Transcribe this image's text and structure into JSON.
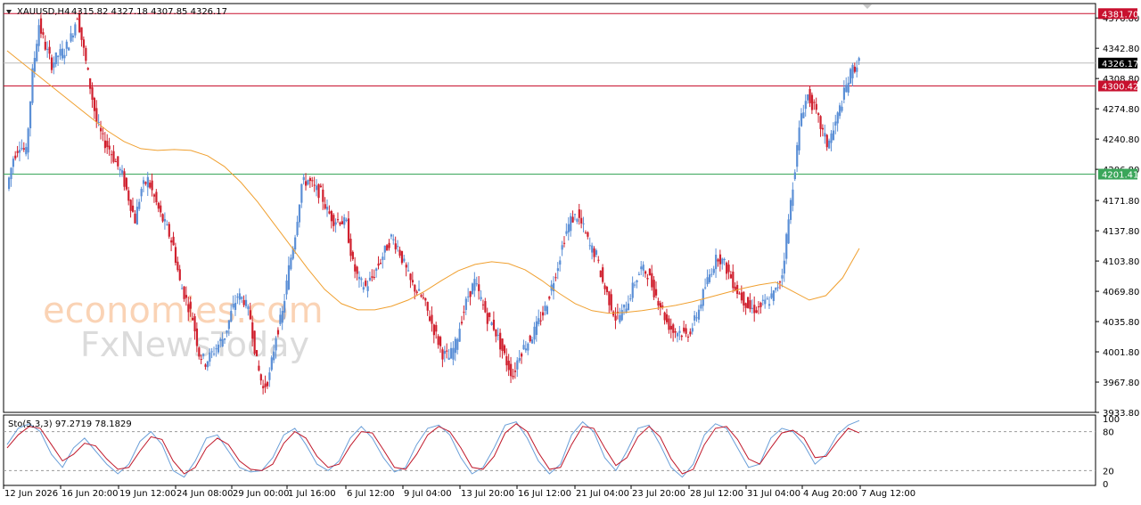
{
  "header": {
    "symbol": "XAUUSD,H4",
    "ohlc": "4315.82 4327.18 4307.85 4326.17",
    "dropdown_icon": "triangle-down-icon"
  },
  "watermark": {
    "brand1": "economies.com",
    "brand2": "FxNewsToday"
  },
  "colors": {
    "bull": "#5b8fd6",
    "bear": "#d0202e",
    "ma": "#f0a030",
    "stoch_k": "#6a9fd8",
    "stoch_d": "#c0182a",
    "resistance": "#c8102e",
    "support": "#3aa65a",
    "current": "#bbbbbb"
  },
  "chart_data": [
    {
      "type": "line",
      "title": "XAUUSD,H4",
      "ylim": [
        3933.8,
        4393
      ],
      "y_ticks": [
        "4376.80",
        "4342.80",
        "4308.80",
        "4274.80",
        "4240.80",
        "4206.80",
        "4171.80",
        "4137.80",
        "4103.80",
        "4069.80",
        "4035.80",
        "4001.80",
        "3967.80",
        "3933.80"
      ],
      "x_tick_labels": [
        "12 Jun 2026",
        "16 Jun 20:00",
        "19 Jun 12:00",
        "24 Jun 08:00",
        "29 Jun 00:00",
        "1 Jul 16:00",
        "6 Jul 12:00",
        "9 Jul 04:00",
        "13 Jul 20:00",
        "16 Jul 12:00",
        "21 Jul 04:00",
        "23 Jul 20:00",
        "28 Jul 12:00",
        "31 Jul 04:00",
        "4 Aug 20:00",
        "7 Aug 12:00"
      ],
      "price_points": [
        4185,
        4220,
        4235,
        4225,
        4315,
        4370,
        4345,
        4325,
        4335,
        4340,
        4355,
        4380,
        4340,
        4300,
        4260,
        4240,
        4230,
        4215,
        4200,
        4175,
        4150,
        4185,
        4195,
        4175,
        4155,
        4140,
        4120,
        4080,
        4060,
        4040,
        4000,
        3990,
        4000,
        4010,
        4020,
        4045,
        4065,
        4060,
        4040,
        3990,
        3960,
        3975,
        4020,
        4045,
        4095,
        4135,
        4190,
        4195,
        4185,
        4180,
        4160,
        4150,
        4150,
        4145,
        4100,
        4080,
        4075,
        4085,
        4100,
        4115,
        4130,
        4120,
        4100,
        4080,
        4070,
        4060,
        4040,
        4020,
        4000,
        3995,
        4010,
        4040,
        4065,
        4080,
        4060,
        4040,
        4030,
        4010,
        3990,
        3975,
        4000,
        4010,
        4020,
        4035,
        4050,
        4075,
        4100,
        4130,
        4150,
        4155,
        4140,
        4120,
        4110,
        4080,
        4060,
        4040,
        4045,
        4060,
        4080,
        4095,
        4090,
        4070,
        4055,
        4035,
        4025,
        4025,
        4020,
        4030,
        4050,
        4075,
        4095,
        4110,
        4100,
        4085,
        4070,
        4060,
        4050,
        4050,
        4055,
        4060,
        4070,
        4090,
        4150,
        4210,
        4270,
        4290,
        4275,
        4255,
        4235,
        4250,
        4275,
        4300,
        4320,
        4326.17
      ],
      "series": [
        {
          "name": "",
          "kind": "moving-average",
          "values": [
            4340,
            4325,
            4310,
            4295,
            4280,
            4265,
            4250,
            4238,
            4230,
            4228,
            4229,
            4228,
            4222,
            4210,
            4192,
            4170,
            4145,
            4120,
            4095,
            4072,
            4056,
            4049,
            4049,
            4053,
            4060,
            4070,
            4082,
            4093,
            4100,
            4103,
            4101,
            4094,
            4082,
            4068,
            4056,
            4048,
            4045,
            4046,
            4048,
            4051,
            4054,
            4058,
            4063,
            4068,
            4073,
            4077,
            4080,
            4070,
            4060,
            4065,
            4085,
            4118
          ]
        }
      ],
      "levels": [
        {
          "label": "4381.70",
          "value": 4381.7,
          "kind": "resistance"
        },
        {
          "label": "4326.17",
          "value": 4326.17,
          "kind": "current"
        },
        {
          "label": "4300.42",
          "value": 4300.42,
          "kind": "resistance"
        },
        {
          "label": "4201.41",
          "value": 4201.41,
          "kind": "support"
        }
      ]
    },
    {
      "type": "line",
      "title": "Sto(5,3,3) 97.2719 78.1829",
      "ylim": [
        0,
        100
      ],
      "y_ticks": [
        "100",
        "80",
        "20",
        "0"
      ],
      "levels": [
        80,
        20
      ],
      "series": [
        {
          "name": "",
          "values": [
            60,
            85,
            92,
            80,
            45,
            25,
            55,
            70,
            50,
            30,
            15,
            30,
            65,
            80,
            60,
            20,
            10,
            35,
            70,
            75,
            50,
            25,
            18,
            20,
            40,
            75,
            85,
            60,
            30,
            20,
            35,
            70,
            88,
            70,
            40,
            18,
            25,
            60,
            85,
            90,
            75,
            40,
            15,
            25,
            55,
            90,
            95,
            70,
            35,
            15,
            30,
            75,
            95,
            80,
            40,
            20,
            50,
            85,
            90,
            60,
            25,
            10,
            30,
            75,
            92,
            85,
            55,
            25,
            30,
            70,
            85,
            80,
            60,
            30,
            45,
            75,
            90,
            97
          ]
        },
        {
          "name": "",
          "values": [
            55,
            75,
            88,
            85,
            60,
            35,
            45,
            62,
            58,
            38,
            22,
            25,
            50,
            72,
            68,
            35,
            15,
            25,
            55,
            70,
            60,
            35,
            22,
            20,
            30,
            62,
            80,
            70,
            42,
            25,
            30,
            58,
            80,
            78,
            52,
            25,
            22,
            45,
            75,
            88,
            80,
            55,
            25,
            22,
            42,
            78,
            92,
            80,
            48,
            22,
            25,
            60,
            88,
            85,
            55,
            28,
            40,
            72,
            88,
            72,
            38,
            15,
            22,
            60,
            85,
            88,
            68,
            38,
            30,
            55,
            78,
            82,
            70,
            40,
            42,
            65,
            85,
            78
          ]
        }
      ]
    }
  ]
}
